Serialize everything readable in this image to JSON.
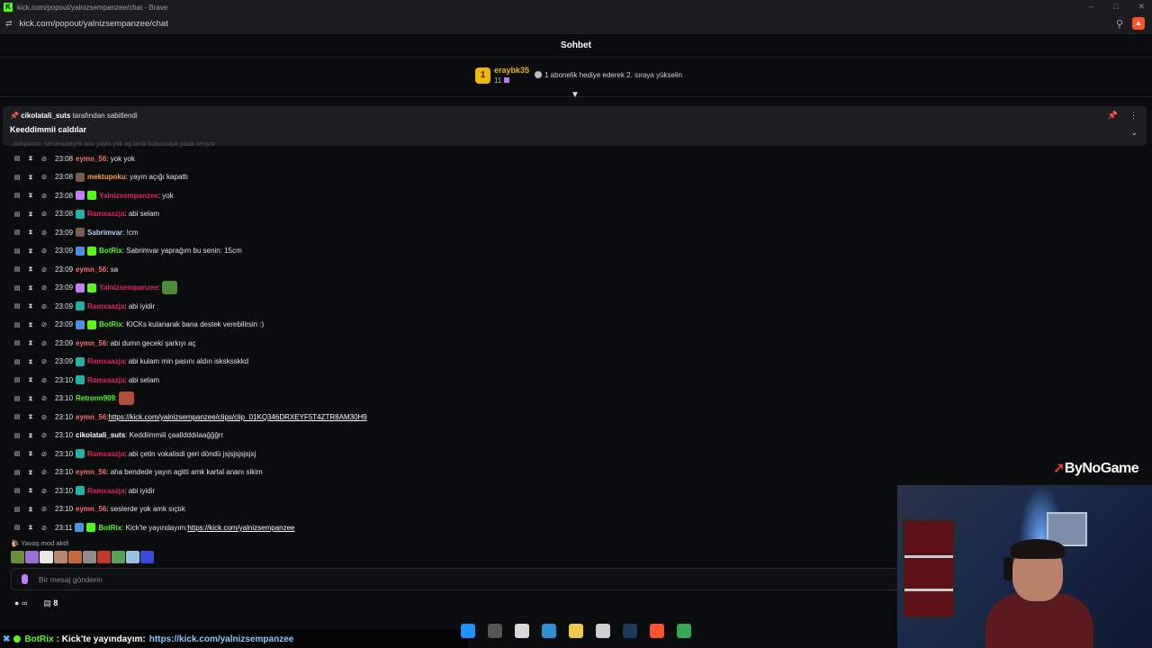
{
  "browser": {
    "title": "kick.com/popout/yalnizsempanzee/chat - Brave",
    "url": "kick.com/popout/yalnizsempanzee/chat"
  },
  "chat": {
    "header": "Sohbet",
    "leader": {
      "rank": "1",
      "username": "eraybk35",
      "count": "11",
      "hint": "1 abonelik hediye ederek 2. sıraya yükselin"
    },
    "pinned": {
      "by_user": "cikolatali_suts",
      "by_suffix": " tarafından sabitlendi",
      "message": "Keeddimmii caldılar"
    },
    "faded_line": "awkymvm: siecerwaeyek anu yayin yok ag lamk kulamcaya yaiak veriyor",
    "messages": [
      {
        "time": "23:08",
        "user": "eymn_56",
        "color": "#ff6b6b",
        "badges": [],
        "text": ": yok yok"
      },
      {
        "time": "23:08",
        "user": "mektupoku",
        "color": "#ff9f43",
        "badges": [
          "#7a5c50"
        ],
        "text": ": yayın açığı kapattı"
      },
      {
        "time": "23:08",
        "user": "Yalnizsempanzee",
        "color": "#e0245e",
        "badges": [
          "#c77dff",
          "#53fc18"
        ],
        "text": ": yok"
      },
      {
        "time": "23:08",
        "user": "Ramxaazja",
        "color": "#e0245e",
        "badges": [
          "#1fb2a6"
        ],
        "text": ": abi selam"
      },
      {
        "time": "23:09",
        "user": "Sabrimvar",
        "color": "#b5d0ff",
        "badges": [
          "#7a5c50"
        ],
        "text": ": !cm"
      },
      {
        "time": "23:09",
        "user": "BotRix",
        "color": "#53fc18",
        "badges": [
          "#4a90e2",
          "#53fc18"
        ],
        "text": ": Sabrimvar yaprağım bu senin: 15cm"
      },
      {
        "time": "23:09",
        "user": "eymn_56",
        "color": "#ff6b6b",
        "badges": [],
        "text": ": sa"
      },
      {
        "time": "23:09",
        "user": "Yalnizsempanzee",
        "color": "#e0245e",
        "badges": [
          "#c77dff",
          "#53fc18"
        ],
        "text": ":",
        "emote": "#4f8a3a"
      },
      {
        "time": "23:09",
        "user": "Ramxaazja",
        "color": "#e0245e",
        "badges": [
          "#1fb2a6"
        ],
        "text": ": abi iyidir"
      },
      {
        "time": "23:09",
        "user": "BotRix",
        "color": "#53fc18",
        "badges": [
          "#4a90e2",
          "#53fc18"
        ],
        "text": ": KICKs kulanarak bana destek verebilirsin :)"
      },
      {
        "time": "23:09",
        "user": "eymn_56",
        "color": "#ff6b6b",
        "badges": [],
        "text": ": abi dumn geceki şarkıyı aç"
      },
      {
        "time": "23:09",
        "user": "Ramxaazja",
        "color": "#e0245e",
        "badges": [
          "#1fb2a6"
        ],
        "text": ": abi kulam min pasını aldın isksksskkd"
      },
      {
        "time": "23:10",
        "user": "Ramxaazja",
        "color": "#e0245e",
        "badges": [
          "#1fb2a6"
        ],
        "text": ": abi selam"
      },
      {
        "time": "23:10",
        "user": "Retronn909",
        "color": "#53fc18",
        "badges": [],
        "text": ":",
        "emote": "#b0503a"
      },
      {
        "time": "23:10",
        "user": "eymn_56",
        "color": "#ff6b6b",
        "badges": [],
        "text": ": ",
        "link": "https://kick.com/yalnizsempanzee/clips/clip_01KQ346DRXEYF5T4ZTR8AM30H9"
      },
      {
        "time": "23:10",
        "user": "cikolatali_suts",
        "color": "#ffffff",
        "badges": [],
        "text": ": Keddiimmiii çaalldddılaağğğrr"
      },
      {
        "time": "23:10",
        "user": "Ramxaazja",
        "color": "#e0245e",
        "badges": [
          "#1fb2a6"
        ],
        "text": ": abi çetin vokalisdi geri döndü jsjsjsjsjsjxj"
      },
      {
        "time": "23:10",
        "user": "eymn_56",
        "color": "#ff6b6b",
        "badges": [],
        "text": ": aha bendede yayın agitti amk kartal ananı sikim"
      },
      {
        "time": "23:10",
        "user": "Ramxaazja",
        "color": "#e0245e",
        "badges": [
          "#1fb2a6"
        ],
        "text": ": abi iyidir"
      },
      {
        "time": "23:10",
        "user": "eymn_56",
        "color": "#ff6b6b",
        "badges": [],
        "text": ": seslerde yok amk sıçtık"
      },
      {
        "time": "23:11",
        "user": "BotRix",
        "color": "#53fc18",
        "badges": [
          "#4a90e2",
          "#53fc18"
        ],
        "text": ": Kick'te yayındayım: ",
        "link": "https://kick.com/yalnizsempanzee"
      }
    ],
    "slow_mode": "Yavaş mod aktif",
    "emote_bar": [
      "#6a8f3a",
      "#9b6fd1",
      "#e8e8e8",
      "#b58a6a",
      "#c26a3a",
      "#8c8c8c",
      "#c0392b",
      "#5aa05a",
      "#9cc0e0",
      "#3a4ad8"
    ],
    "input_placeholder": "Bir mesaj gönderin",
    "tools": {
      "infinity": "∞",
      "count": "8"
    }
  },
  "overlay": {
    "watermark": "ByNoGame",
    "ticker": {
      "name": "BotRix",
      "text": ": Kick'te yayındayım:",
      "link": "https://kick.com/yalnizsempanzee"
    }
  },
  "taskbar_icons": [
    "#1e90ff",
    "#555",
    "#d8d8d8",
    "#2f8fd1",
    "#f2c94c",
    "#cfcfcf",
    "#1c3a5a",
    "#fb542b",
    "#34a853"
  ]
}
